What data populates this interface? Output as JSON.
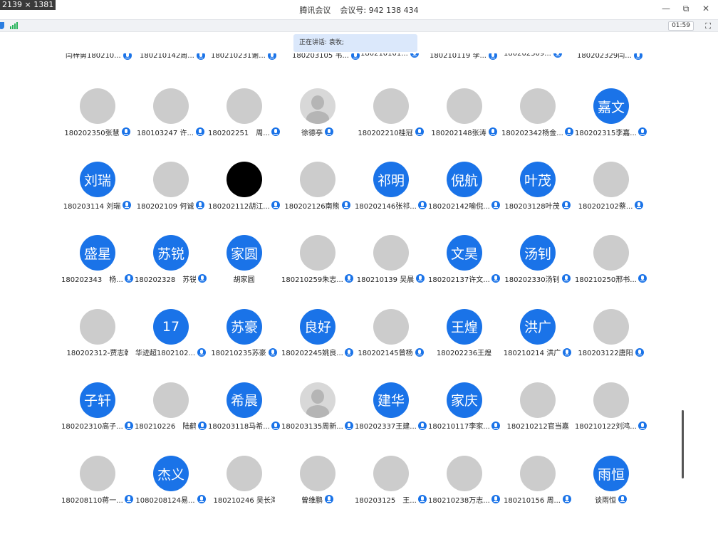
{
  "window": {
    "dims_tag": "2139 × 1381",
    "title_app": "腾讯会议",
    "title_meeting_label": "会议号:",
    "title_meeting_id": "942 138 434",
    "controls": {
      "minimize": "—",
      "restore": "⧉",
      "close": "✕"
    }
  },
  "toolbar": {
    "timer": "01:59",
    "fullscreen_icon": "⛶"
  },
  "speaking_banner": "正在讲话: 袁牧;",
  "partial_row": [
    "闫梓勇180210...",
    "180210142周...",
    "180210231谢...",
    "180203105 韦...",
    "180210101...",
    "180210119 李...",
    "180202309...",
    "180202329闫..."
  ],
  "participants": [
    [
      {
        "name": "180202350张慧",
        "avatar": "photo",
        "style": "ph1"
      },
      {
        "name": "180103247 许...",
        "avatar": "photo",
        "style": "ph2"
      },
      {
        "name": "180202251　周...",
        "avatar": "photo",
        "style": "ph3"
      },
      {
        "name": "徐德亭",
        "avatar": "gray"
      },
      {
        "name": "180202210桂冠",
        "avatar": "photo",
        "style": "ph4"
      },
      {
        "name": "180202148张涛",
        "avatar": "photo",
        "style": "ph5"
      },
      {
        "name": "180202342杨金...",
        "avatar": "photo",
        "style": "ph6"
      },
      {
        "name": "180202315李嘉...",
        "avatar": "text",
        "text": "嘉文"
      }
    ],
    [
      {
        "name": "180203114 刘瑞",
        "avatar": "text",
        "text": "刘瑞"
      },
      {
        "name": "180202109 何诚",
        "avatar": "photo",
        "style": "ph7"
      },
      {
        "name": "180202112胡江...",
        "avatar": "black"
      },
      {
        "name": "180202126南熊",
        "avatar": "photo",
        "style": "ph8"
      },
      {
        "name": "180202146张祁...",
        "avatar": "text",
        "text": "祁明"
      },
      {
        "name": "180202142喻倪...",
        "avatar": "text",
        "text": "倪航"
      },
      {
        "name": "180203128叶茂",
        "avatar": "text",
        "text": "叶茂"
      },
      {
        "name": "180202102蔡...",
        "avatar": "photo",
        "style": "ph9"
      }
    ],
    [
      {
        "name": "180202343　杨...",
        "avatar": "text",
        "text": "盛星"
      },
      {
        "name": "180202328　苏锐",
        "avatar": "text",
        "text": "苏锐"
      },
      {
        "name": "胡家圆",
        "avatar": "text",
        "text": "家圆",
        "nomic": true
      },
      {
        "name": "180210259朱志...",
        "avatar": "photo",
        "style": "ph10"
      },
      {
        "name": "180210139 吴晨",
        "avatar": "photo",
        "style": "ph11"
      },
      {
        "name": "180202137许文...",
        "avatar": "text",
        "text": "文昊"
      },
      {
        "name": "180202330汤钊",
        "avatar": "text",
        "text": "汤钊"
      },
      {
        "name": "180210250邢书...",
        "avatar": "photo",
        "style": "ph12"
      }
    ],
    [
      {
        "name": "180202312-贾志乾",
        "avatar": "photo",
        "style": "ph13",
        "nomic": true
      },
      {
        "name": "华迹超1802102...",
        "avatar": "text",
        "text": "17"
      },
      {
        "name": "180210235苏豪",
        "avatar": "text",
        "text": "苏豪"
      },
      {
        "name": "180202245姚良...",
        "avatar": "text",
        "text": "良好"
      },
      {
        "name": "180202145曾杨",
        "avatar": "photo",
        "style": "ph14"
      },
      {
        "name": "180202236王煌",
        "avatar": "text",
        "text": "王煌",
        "nomic": true
      },
      {
        "name": "180210214 洪广",
        "avatar": "text",
        "text": "洪广"
      },
      {
        "name": "180203122唐阳",
        "avatar": "photo",
        "style": "ph15"
      }
    ],
    [
      {
        "name": "180202310高子...",
        "avatar": "text",
        "text": "子轩"
      },
      {
        "name": "180210226　陆鹤",
        "avatar": "photo",
        "style": "ph16"
      },
      {
        "name": "180203118马希...",
        "avatar": "text",
        "text": "希晨"
      },
      {
        "name": "180203135周新...",
        "avatar": "gray"
      },
      {
        "name": "180202337王建...",
        "avatar": "text",
        "text": "建华"
      },
      {
        "name": "180210117李家...",
        "avatar": "text",
        "text": "家庆"
      },
      {
        "name": "180210212官当嘉",
        "avatar": "photo",
        "style": "ph17",
        "nomic": true
      },
      {
        "name": "180210122刘鸿...",
        "avatar": "photo",
        "style": "ph18"
      }
    ],
    [
      {
        "name": "180208110蒋一...",
        "avatar": "photo",
        "style": "ph19"
      },
      {
        "name": "1080208124易...",
        "avatar": "text",
        "text": "杰义"
      },
      {
        "name": "180210246 吴长海",
        "avatar": "photo",
        "style": "ph20",
        "nomic": true
      },
      {
        "name": "曾维鹏",
        "avatar": "photo",
        "style": "ph21"
      },
      {
        "name": "180203125　王...",
        "avatar": "photo",
        "style": "ph22"
      },
      {
        "name": "180210238万志...",
        "avatar": "photo",
        "style": "ph23"
      },
      {
        "name": "180210156 周...",
        "avatar": "photo",
        "style": "ph24"
      },
      {
        "name": "谈雨恒",
        "avatar": "text",
        "text": "雨恒"
      }
    ]
  ]
}
